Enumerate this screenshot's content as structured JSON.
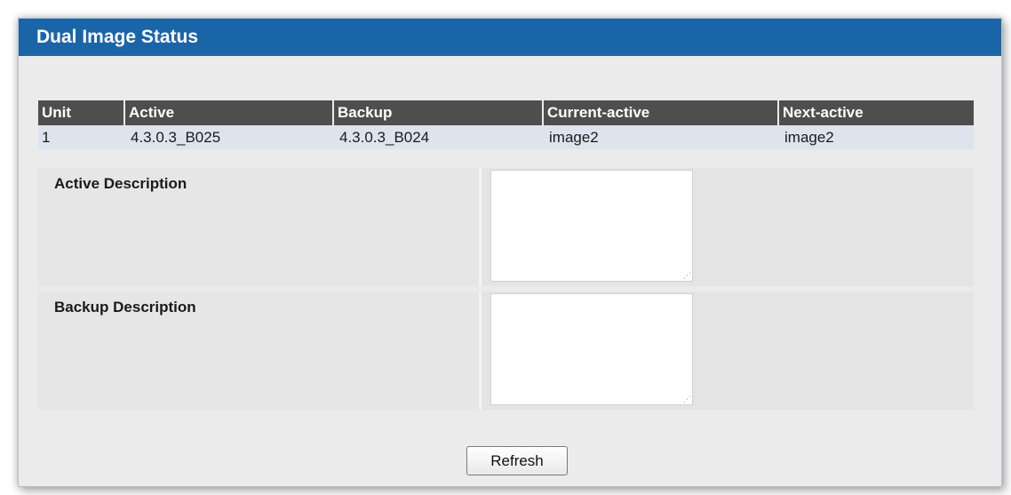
{
  "panel": {
    "title": "Dual Image Status"
  },
  "table": {
    "headers": [
      "Unit",
      "Active",
      "Backup",
      "Current-active",
      "Next-active"
    ],
    "rows": [
      [
        "1",
        "4.3.0.3_B025",
        "4.3.0.3_B024",
        "image2",
        "image2"
      ]
    ]
  },
  "active_description": {
    "label": "Active Description",
    "value": ""
  },
  "backup_description": {
    "label": "Backup Description",
    "value": ""
  },
  "actions": {
    "refresh_label": "Refresh"
  },
  "colors": {
    "title_bar": "#1a65a8",
    "header_row": "#4e4e4e",
    "data_row": "#dde4ee",
    "panel_background": "#ebebeb"
  }
}
